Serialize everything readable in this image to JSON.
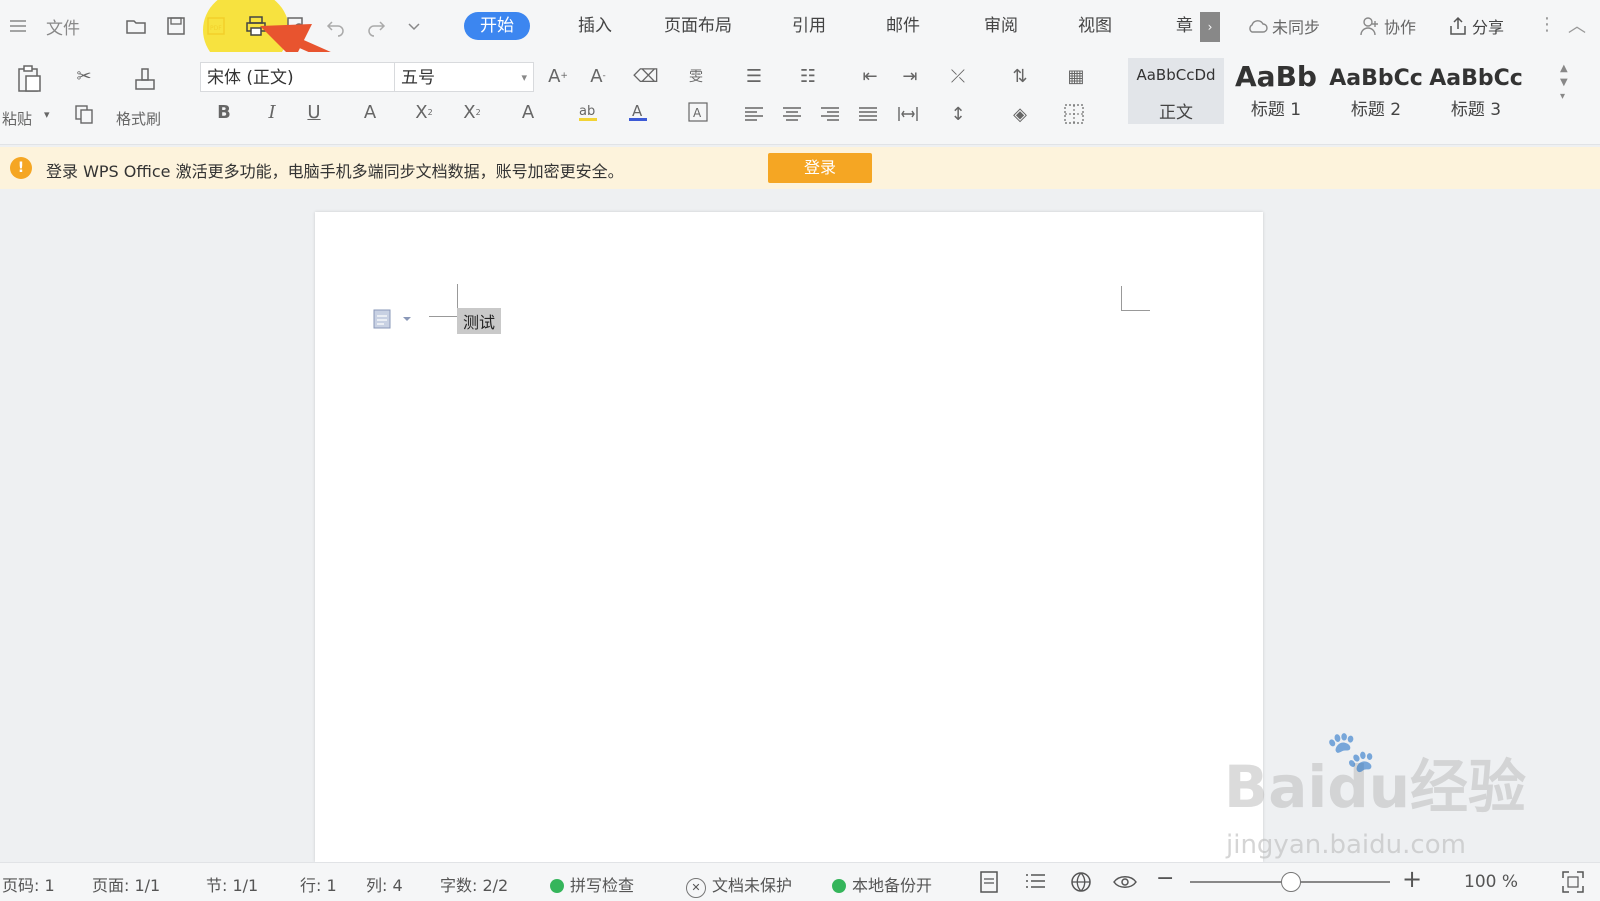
{
  "menu": {
    "file_label": "文件"
  },
  "tabs": [
    {
      "label": "开始",
      "active": true
    },
    {
      "label": "插入"
    },
    {
      "label": "页面布局"
    },
    {
      "label": "引用"
    },
    {
      "label": "邮件"
    },
    {
      "label": "审阅"
    },
    {
      "label": "视图"
    },
    {
      "label": "章"
    }
  ],
  "right_actions": {
    "sync": "未同步",
    "collab": "协作",
    "share": "分享"
  },
  "ribbon": {
    "paste": "粘贴",
    "format_painter": "格式刷",
    "font_name": "宋体 (正文)",
    "font_size": "五号",
    "styles": [
      {
        "preview": "AaBbCcDd",
        "name": "正文"
      },
      {
        "preview": "AaBb",
        "name": "标题 1"
      },
      {
        "preview": "AaBbCc",
        "name": "标题 2"
      },
      {
        "preview": "AaBbCc",
        "name": "标题 3"
      }
    ]
  },
  "notice": {
    "message": "登录 WPS Office 激活更多功能，电脑手机多端同步文档数据，账号加密更安全。",
    "button": "登录"
  },
  "document": {
    "text": "测试"
  },
  "status": {
    "page_no": "页码: 1",
    "pages": "页面: 1/1",
    "section": "节: 1/1",
    "row": "行: 1",
    "col": "列: 4",
    "words": "字数: 2/2",
    "spell": "拼写检查",
    "protect": "文档未保护",
    "backup": "本地备份开",
    "zoom": "100 %"
  },
  "watermark": {
    "brand": "Baidu经验",
    "url": "jingyan.baidu.com"
  },
  "colors": {
    "accent": "#3c86f0",
    "notice_bg": "#fdf3dc",
    "login_btn": "#f5a623",
    "annotation_arrow": "#e8542f",
    "highlight_circle": "#f7e02a"
  }
}
